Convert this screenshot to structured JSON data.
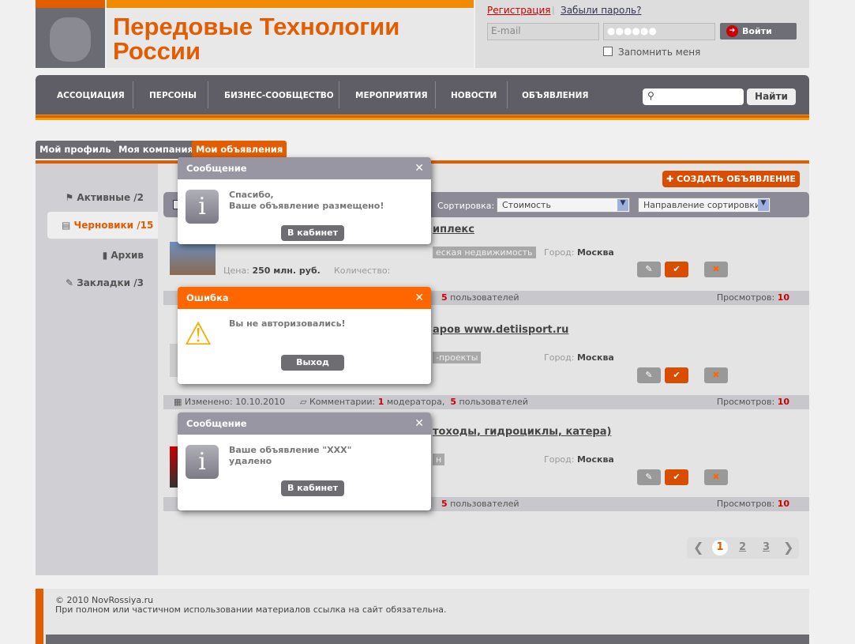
{
  "header": {
    "title_line1": "Передовые Технологии",
    "title_line2": "России",
    "register": "Регистрация",
    "forgot": "Забыли пароль?",
    "email_placeholder": "E-mail",
    "password_value": "●●●●●●",
    "login_button": "Войти",
    "remember": "Запомнить меня"
  },
  "nav": {
    "items": [
      "АССОЦИАЦИЯ",
      "ПЕРСОНЫ",
      "БИЗНЕС-СООБЩЕСТВО",
      "МЕРОПРИЯТИЯ",
      "НОВОСТИ",
      "ОБЪЯВЛЕНИЯ"
    ],
    "search_button": "Найти",
    "search_placeholder": ""
  },
  "tabs": [
    "Мой профиль",
    "Моя компания",
    "Мои объявления"
  ],
  "sidebar": {
    "items": [
      {
        "label": "Активные /2",
        "icon": "flag-icon"
      },
      {
        "label": "Черновики /15",
        "icon": "notepad-icon",
        "active": true
      },
      {
        "label": "Архив",
        "icon": "book-icon"
      },
      {
        "label": "Закладки /3",
        "icon": "bookmark-icon"
      }
    ]
  },
  "create_button": "СОЗДАТЬ ОБЪЯВЛЕНИЕ",
  "toolbar": {
    "sort_label": "Сортировка:",
    "sort_value": "Стоимость",
    "direction_value": "Направление сортировки"
  },
  "listings": [
    {
      "title": "иплекс",
      "tag": "еская недвижимость",
      "city_label": "Город:",
      "city": "Москва",
      "price_label": "Цена:",
      "price": "250 млн. руб.",
      "qty_label": "Количество:",
      "comments_mod": "",
      "comments_users": "5",
      "users_label": "пользователей",
      "views_label": "Просмотров:",
      "views": "10"
    },
    {
      "title": "аров www.detiisport.ru",
      "tag": "-проекты",
      "city_label": "Город:",
      "city": "Москва",
      "changed": "Изменено: 10.10.2010",
      "comments_label": "Комментарии:",
      "comments_mod": "1",
      "mod_label": "модератора,",
      "comments_users": "5",
      "users_label": "пользователей",
      "views_label": "Просмотров:",
      "views": "10"
    },
    {
      "title": "тоходы, гидроциклы, катера)",
      "tag": "н",
      "city_label": "Город:",
      "city": "Москва",
      "comments_users": "5",
      "users_label": "пользователей",
      "views_label": "Просмотров:",
      "views": "10"
    }
  ],
  "dialogs": [
    {
      "title": "Сообщение",
      "message": "Спасибо,\nВаше объявление размещено!",
      "button": "В кабинет",
      "type": "info",
      "color": "#9896a2"
    },
    {
      "title": "Ошибка",
      "message": "Вы не авторизовались!",
      "button": "Выход",
      "type": "warning",
      "color": "#ff6600"
    },
    {
      "title": "Сообщение",
      "message": "Ваше объявление \"XXX\"\nудалено",
      "button": "В кабинет",
      "type": "info",
      "color": "#9896a2"
    }
  ],
  "pagination": {
    "pages": [
      "1",
      "2",
      "3"
    ],
    "current": "1"
  },
  "footer": {
    "copyright": "© 2010 NovRossiya.ru",
    "notice": "При полном или частичном использовании материалов ссылка на сайт обязательна."
  }
}
